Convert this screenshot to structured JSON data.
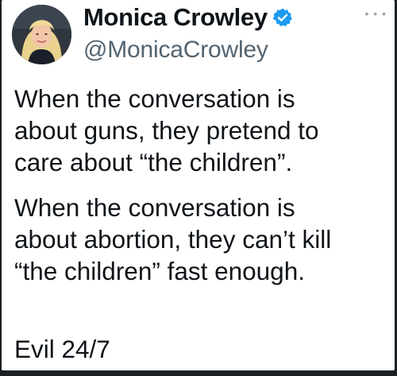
{
  "tweet": {
    "author": {
      "display_name": "Monica Crowley",
      "handle": "@MonicaCrowley",
      "verified": true,
      "verified_color": "#1d9bf0",
      "avatar_icon": "profile-photo"
    },
    "more_icon": "more-icon",
    "paragraphs": [
      "When the conversation is\nabout guns, they pretend to\ncare about “the children”.",
      "When the conversation is\nabout abortion, they can’t kill\n“the children” fast enough."
    ],
    "closing": "Evil 24/7"
  },
  "colors": {
    "background": "#1c1f23",
    "card": "#ffffff",
    "text": "#0f1419",
    "secondary_text": "#536471"
  }
}
